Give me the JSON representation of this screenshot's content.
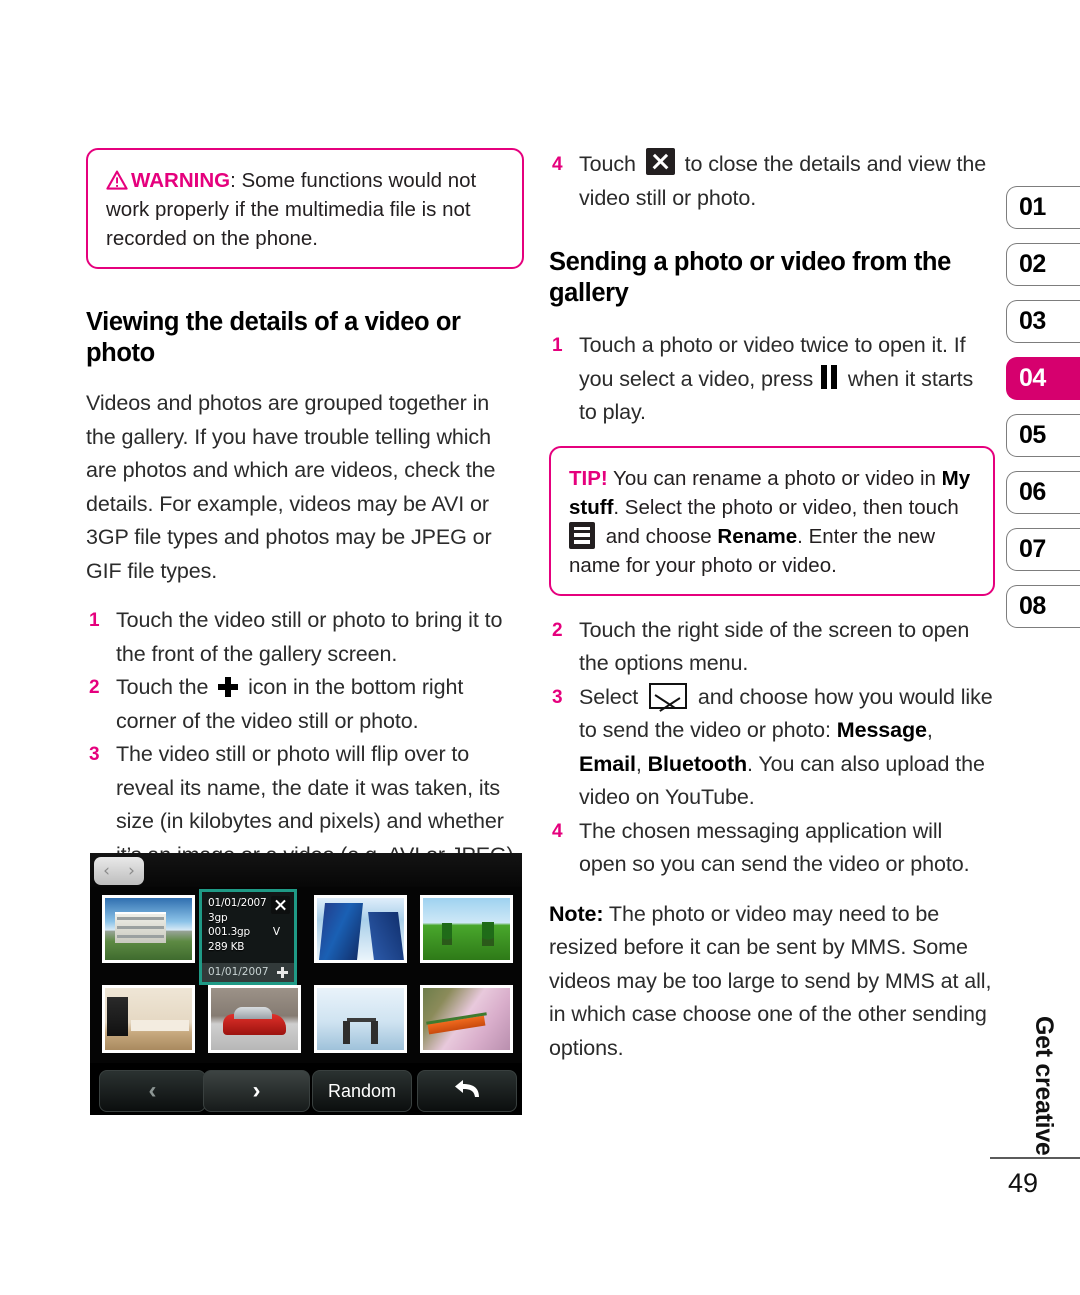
{
  "warning_box": {
    "label": "WARNING",
    "icon": "warning-triangle-icon",
    "separator": ": ",
    "text": "Some functions would not work properly if the multimedia file is not recorded on the phone."
  },
  "left_column": {
    "heading": "Viewing the details of a video or photo",
    "intro": "Videos and photos are grouped together in the gallery. If you have trouble telling which are photos and which are videos, check the details. For example, videos may be AVI or 3GP file types and photos may be JPEG or GIF file types.",
    "steps": [
      {
        "num": "1",
        "text": "Touch the video still or photo to bring it to the front of the gallery screen."
      },
      {
        "num": "2",
        "pre": "Touch the ",
        "icon": "plus-icon",
        "post": " icon in the bottom right corner of the video still or photo."
      },
      {
        "num": "3",
        "text": "The video still or photo will flip over to reveal its name, the date it was taken, its size (in kilobytes and pixels) and whether it’s an image or a video (e.g. AVI or JPEG)."
      }
    ]
  },
  "right_column": {
    "step4_top": {
      "num": "4",
      "pre": "Touch ",
      "icon": "close-x-icon",
      "post": " to close the details and view the video still or photo."
    },
    "heading": "Sending a photo or video from the gallery",
    "step1": {
      "num": "1",
      "pre": "Touch a photo or video twice to open it. If you select a video, press ",
      "icon": "pause-icon",
      "post": " when it starts to play."
    },
    "tip_box": {
      "label": "TIP!",
      "icon": "menu-list-icon",
      "part1": " You can rename a photo or video in ",
      "bold1": "My stuff",
      "part2": ". Select the photo or video, then touch ",
      "part3": " and choose ",
      "bold2": "Rename",
      "part4": ". Enter the new name for your photo or video."
    },
    "step2": {
      "num": "2",
      "text": "Touch the right side of the screen to open the options menu."
    },
    "step3": {
      "num": "3",
      "pre": "Select ",
      "icon": "envelope-icon",
      "mid": " and choose how you would like to send the video or photo: ",
      "bold1": "Message",
      "sep1": ", ",
      "bold2": "Email",
      "sep2": ", ",
      "bold3": "Bluetooth",
      "post": ". You can also upload the video on YouTube."
    },
    "step4": {
      "num": "4",
      "text": "The chosen messaging application will open so you can send the video or photo."
    },
    "note": {
      "label": "Note:",
      "text": " The photo or video may need to be resized before it can be sent by MMS. Some videos may be too large to send by MMS at all, in which case choose one of the other sending options."
    }
  },
  "phone_screenshot": {
    "nav_pill": {
      "prev": "‹",
      "next": "›"
    },
    "detail_card": {
      "date": "01/01/2007",
      "type": "3gp",
      "filename": "001.3gp",
      "flag": "V",
      "size": "289 KB",
      "footer_date": "01/01/2007",
      "close_icon": "close-x-icon",
      "plus_icon": "plus-icon"
    },
    "thumbnails": [
      {
        "name": "office-building"
      },
      {
        "name": "skyscraper"
      },
      {
        "name": "green-field-trees"
      },
      {
        "name": "kitchen"
      },
      {
        "name": "red-car"
      },
      {
        "name": "dining-room"
      },
      {
        "name": "cherry-blossom"
      }
    ],
    "buttons": {
      "prev": "‹",
      "next": "›",
      "random": "Random",
      "back_icon": "return-arrow-icon"
    }
  },
  "side_tabs": {
    "items": [
      "01",
      "02",
      "03",
      "04",
      "05",
      "06",
      "07",
      "08"
    ],
    "active": "04",
    "active_color": "#d6006e"
  },
  "footer": {
    "chapter": "Get creative",
    "page_number": "49"
  },
  "colors": {
    "accent_pink": "#e5007d",
    "tab_magenta": "#d6006e",
    "text": "#2b2b2b"
  }
}
